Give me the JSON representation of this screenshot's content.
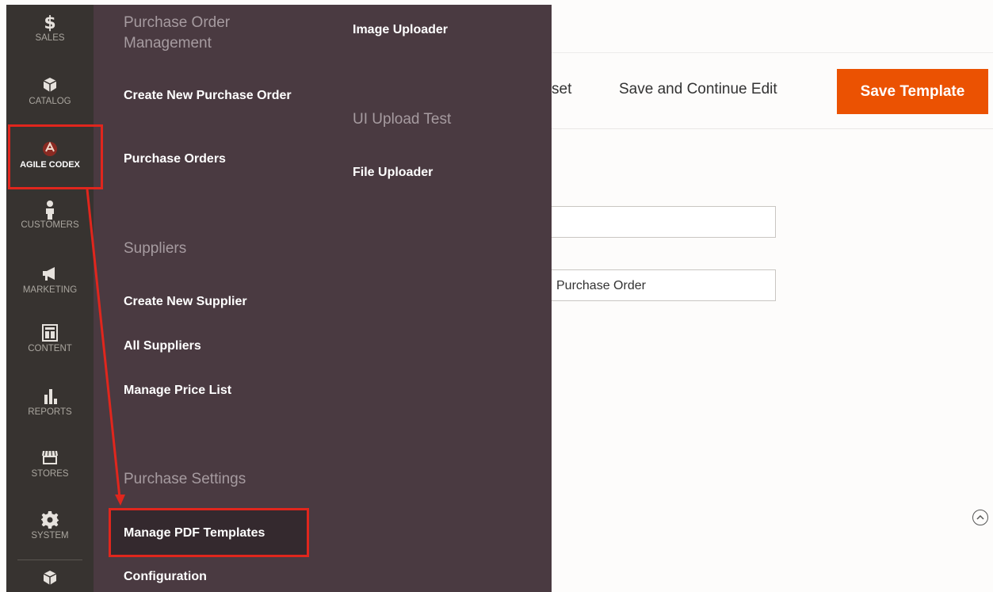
{
  "sidebar": {
    "items": [
      {
        "label": "SALES",
        "icon": "dollar-icon"
      },
      {
        "label": "CATALOG",
        "icon": "catalog-box-icon"
      },
      {
        "label": "AGILE CODEX",
        "icon": "agile-codex-logo-icon"
      },
      {
        "label": "CUSTOMERS",
        "icon": "person-icon"
      },
      {
        "label": "MARKETING",
        "icon": "megaphone-icon"
      },
      {
        "label": "CONTENT",
        "icon": "content-layout-icon"
      },
      {
        "label": "REPORTS",
        "icon": "bar-chart-icon"
      },
      {
        "label": "STORES",
        "icon": "storefront-icon"
      },
      {
        "label": "SYSTEM",
        "icon": "gear-icon"
      },
      {
        "label": "",
        "icon": "extensions-box-icon"
      }
    ]
  },
  "flyout": {
    "col1": {
      "group_purchase_orders": "Purchase Order Management",
      "create_po": "Create New Purchase Order",
      "purchase_orders": "Purchase Orders",
      "group_suppliers": "Suppliers",
      "create_supplier": "Create New Supplier",
      "all_suppliers": "All Suppliers",
      "manage_price_list": "Manage Price List",
      "group_settings": "Purchase Settings",
      "manage_pdf_templates": "Manage PDF Templates",
      "configuration": "Configuration"
    },
    "col2": {
      "image_uploader": "Image Uploader",
      "group_ui_upload": "UI Upload Test",
      "file_uploader": "File Uploader"
    }
  },
  "toolbar": {
    "reset_partial": "set",
    "save_continue": "Save and Continue Edit",
    "save_template": "Save Template"
  },
  "form": {
    "field1_value": "",
    "field2_value": "Purchase Order"
  },
  "colors": {
    "nav_bg": "#373330",
    "flyout_bg": "#4a3a41",
    "accent_orange": "#eb5202",
    "annotation_red": "#e0261d"
  }
}
